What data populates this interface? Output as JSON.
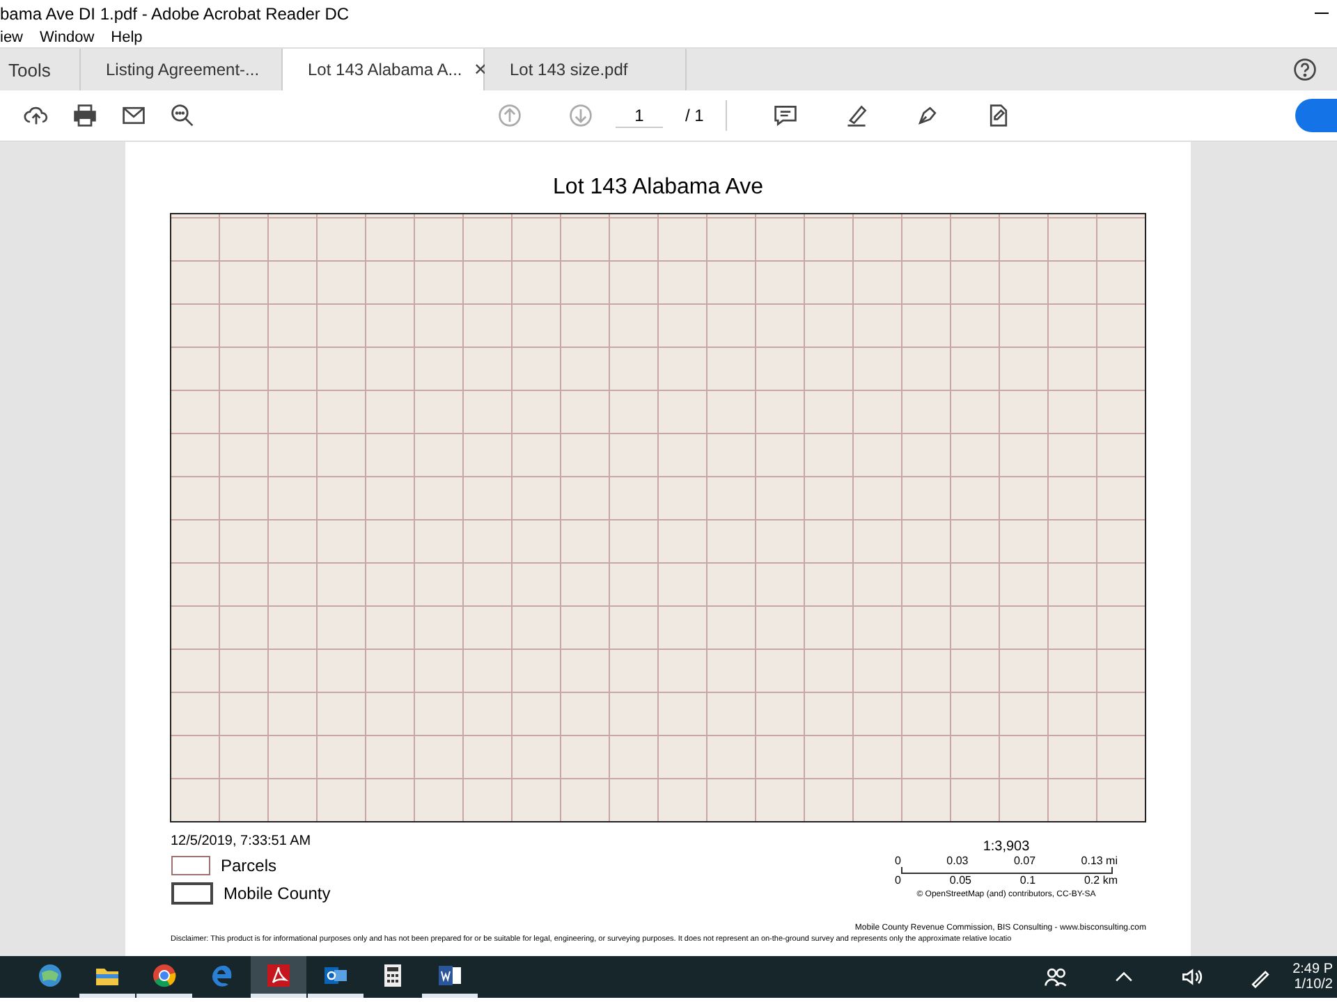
{
  "window": {
    "title": "bama Ave DI 1.pdf - Adobe Acrobat Reader DC"
  },
  "menu": [
    "iew",
    "Window",
    "Help"
  ],
  "tabs": [
    {
      "label": "Tools",
      "kind": "tools",
      "selected": false
    },
    {
      "label": "Listing Agreement-...",
      "kind": "doc",
      "selected": false
    },
    {
      "label": "Lot 143 Alabama A...",
      "kind": "doc",
      "selected": true,
      "close": "✕"
    },
    {
      "label": "Lot 143 size.pdf",
      "kind": "doc",
      "selected": false
    }
  ],
  "toolbar": {
    "page": "1",
    "page_total": "/ 1"
  },
  "document": {
    "title": "Lot 143 Alabama Ave",
    "timestamp": "12/5/2019, 7:33:51 AM",
    "legend": [
      {
        "label": "Parcels",
        "kind": "parcel"
      },
      {
        "label": "Mobile County",
        "kind": "county"
      }
    ],
    "scale": {
      "ratio": "1:3,903",
      "miles": [
        "0",
        "0.03",
        "0.07",
        "0.13 mi"
      ],
      "km": [
        "0",
        "0.05",
        "0.1",
        "0.2 km"
      ],
      "credit": "© OpenStreetMap (and) contributors, CC-BY-SA"
    },
    "source": "Mobile County Revenue Commission, BIS Consulting - www.bisconsulting.com",
    "disclaimer": "Disclaimer: This product is for informational purposes only and has not been prepared for or be suitable for legal, engineering, or surveying purposes. It does not represent an on-the-ground survey and represents only the approximate relative locatio"
  },
  "taskbar": {
    "icons": [
      {
        "kind": "globe",
        "open": false,
        "selected": false
      },
      {
        "kind": "folder",
        "open": true,
        "selected": false
      },
      {
        "kind": "chrome",
        "open": true,
        "selected": false
      },
      {
        "kind": "edge",
        "open": false,
        "selected": false
      },
      {
        "kind": "pdf",
        "open": true,
        "selected": true
      },
      {
        "kind": "mail",
        "open": true,
        "selected": false
      },
      {
        "kind": "calculator",
        "open": false,
        "selected": false
      },
      {
        "kind": "word",
        "open": true,
        "selected": false
      }
    ],
    "time": "2:49 P",
    "date": "1/10/2"
  }
}
